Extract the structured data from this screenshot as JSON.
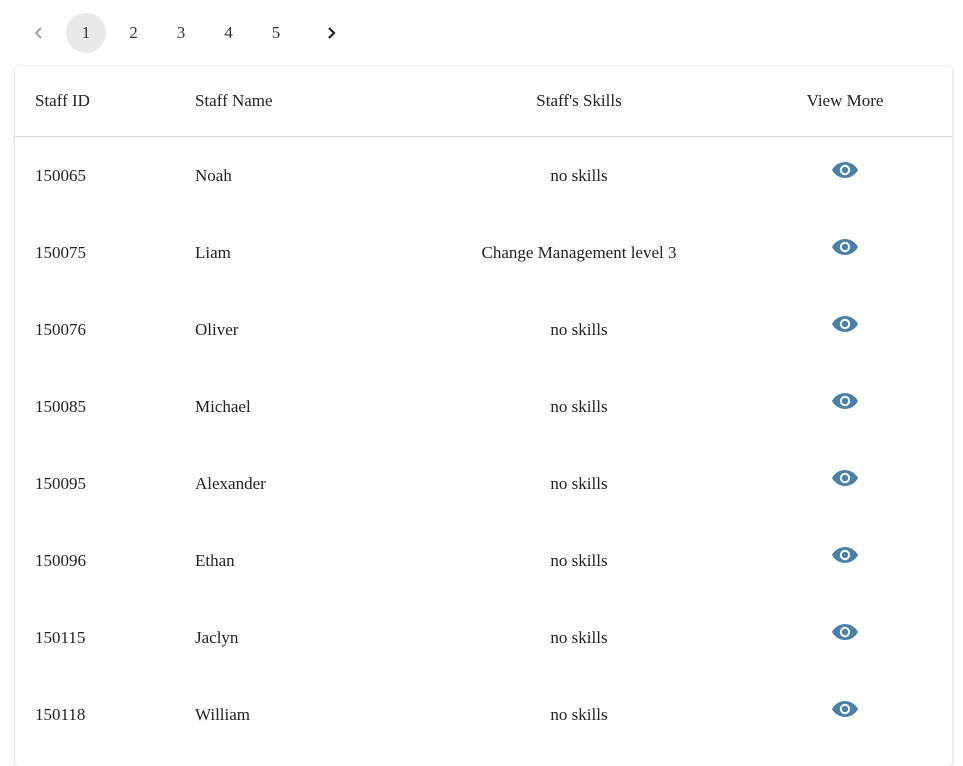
{
  "pagination": {
    "pages": [
      "1",
      "2",
      "3",
      "4",
      "5"
    ],
    "current": "1",
    "prev_icon": "chevron-left-icon",
    "next_icon": "chevron-right-icon"
  },
  "table": {
    "headers": {
      "staff_id": "Staff ID",
      "staff_name": "Staff Name",
      "skills": "Staff's Skills",
      "view_more": "View More"
    },
    "view_icon": "eye-icon",
    "rows": [
      {
        "id": "150065",
        "name": "Noah",
        "skills": "no skills"
      },
      {
        "id": "150075",
        "name": "Liam",
        "skills": "Change Management level 3"
      },
      {
        "id": "150076",
        "name": "Oliver",
        "skills": "no skills"
      },
      {
        "id": "150085",
        "name": "Michael",
        "skills": "no skills"
      },
      {
        "id": "150095",
        "name": "Alexander",
        "skills": "no skills"
      },
      {
        "id": "150096",
        "name": "Ethan",
        "skills": "no skills"
      },
      {
        "id": "150115",
        "name": "Jaclyn",
        "skills": "no skills"
      },
      {
        "id": "150118",
        "name": "William",
        "skills": "no skills"
      }
    ]
  },
  "colors": {
    "accent": "#4a7fa7",
    "active_page_bg": "#e8e8e8"
  }
}
